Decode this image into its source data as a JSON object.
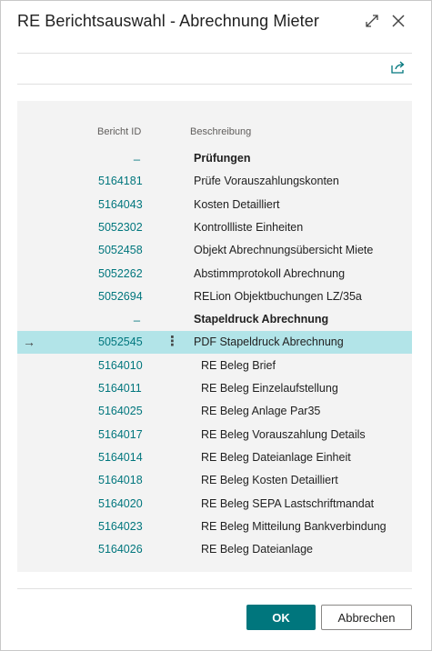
{
  "dialog": {
    "title": "RE Berichtsauswahl - Abrechnung Mieter",
    "expand_icon": "expand-icon",
    "close_icon": "close-icon",
    "share_icon": "share-icon"
  },
  "table": {
    "headers": {
      "id": "Bericht ID",
      "description": "Beschreibung"
    },
    "rows": [
      {
        "id": "_",
        "description": "Prüfungen",
        "type": "group"
      },
      {
        "id": "5164181",
        "description": "Prüfe Vorauszahlungskonten",
        "type": "item"
      },
      {
        "id": "5164043",
        "description": "Kosten Detailliert",
        "type": "item"
      },
      {
        "id": "5052302",
        "description": "Kontrollliste Einheiten",
        "type": "item"
      },
      {
        "id": "5052458",
        "description": "Objekt Abrechnungsübersicht Miete",
        "type": "item"
      },
      {
        "id": "5052262",
        "description": "Abstimmprotokoll Abrechnung",
        "type": "item"
      },
      {
        "id": "5052694",
        "description": "RELion Objektbuchungen LZ/35a",
        "type": "item"
      },
      {
        "id": "_",
        "description": "Stapeldruck Abrechnung",
        "type": "group"
      },
      {
        "id": "5052545",
        "description": "PDF Stapeldruck Abrechnung",
        "type": "item",
        "selected": true
      },
      {
        "id": "5164010",
        "description": "RE Beleg Brief",
        "type": "sub"
      },
      {
        "id": "5164011",
        "description": "RE Beleg Einzelaufstellung",
        "type": "sub"
      },
      {
        "id": "5164025",
        "description": "RE Beleg Anlage Par35",
        "type": "sub"
      },
      {
        "id": "5164017",
        "description": "RE Beleg Vorauszahlung Details",
        "type": "sub"
      },
      {
        "id": "5164014",
        "description": "RE Beleg Dateianlage Einheit",
        "type": "sub"
      },
      {
        "id": "5164018",
        "description": "RE Beleg Kosten Detailliert",
        "type": "sub"
      },
      {
        "id": "5164020",
        "description": "RE Beleg SEPA Lastschriftmandat",
        "type": "sub"
      },
      {
        "id": "5164023",
        "description": "RE Beleg Mitteilung Bankverbindung",
        "type": "sub"
      },
      {
        "id": "5164026",
        "description": "RE Beleg Dateianlage",
        "type": "sub"
      }
    ],
    "selected_row_indicator": "→",
    "row_menu_glyph": "⋮"
  },
  "buttons": {
    "ok": "OK",
    "cancel": "Abbrechen"
  },
  "colors": {
    "accent": "#00767d",
    "selected_row": "#b2e4e8",
    "grid_bg": "#f3f3f3"
  }
}
